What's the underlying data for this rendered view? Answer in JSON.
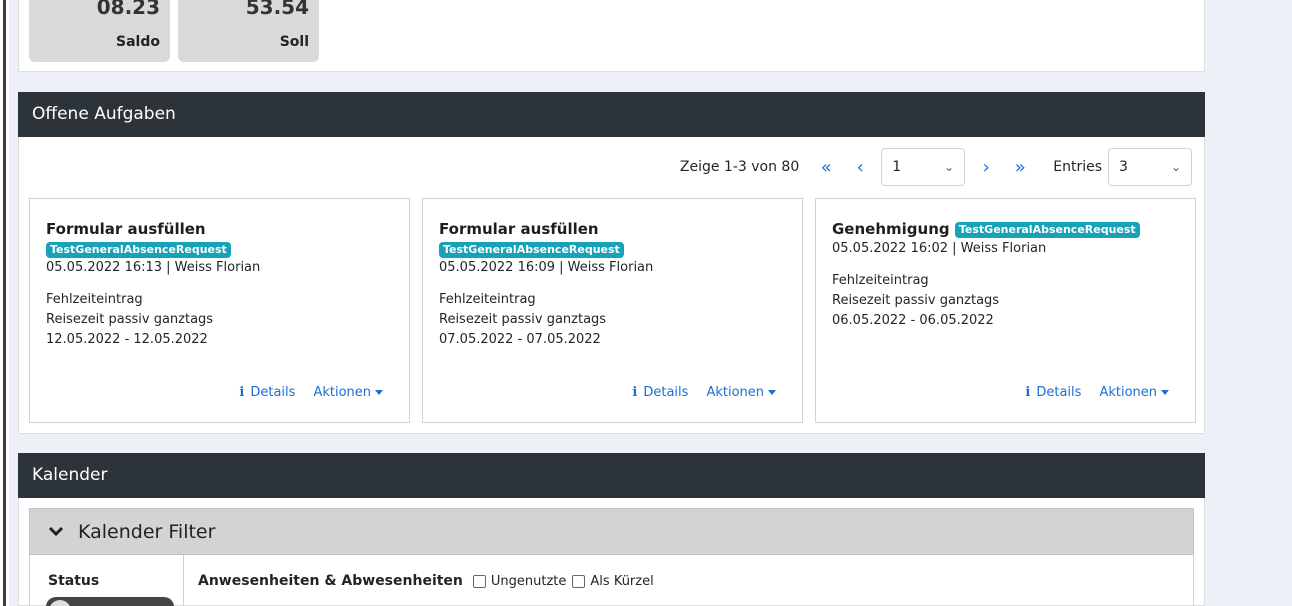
{
  "stats": [
    {
      "value": "08.23",
      "label": "Saldo"
    },
    {
      "value": "53.54",
      "label": "Soll"
    }
  ],
  "tasks_section": {
    "title": "Offene Aufgaben",
    "pager": {
      "info": "Zeige 1-3 von 80",
      "first_icon": "«",
      "prev_icon": "‹",
      "page_value": "1",
      "next_icon": "›",
      "last_icon": "»",
      "entries_label": "Entries",
      "entries_value": "3"
    },
    "cards": [
      {
        "title": "Formular ausfüllen",
        "badge": "TestGeneralAbsenceRequest",
        "meta": "05.05.2022 16:13 | Weiss Florian",
        "line1": "Fehlzeiteintrag",
        "line2": "Reisezeit passiv ganztags",
        "line3": "12.05.2022 - 12.05.2022",
        "details": "Details",
        "actions": "Aktionen"
      },
      {
        "title": "Formular ausfüllen",
        "badge": "TestGeneralAbsenceRequest",
        "meta": "05.05.2022 16:09 | Weiss Florian",
        "line1": "Fehlzeiteintrag",
        "line2": "Reisezeit passiv ganztags",
        "line3": "07.05.2022 - 07.05.2022",
        "details": "Details",
        "actions": "Aktionen"
      },
      {
        "title": "Genehmigung",
        "badge": "TestGeneralAbsenceRequest",
        "meta": "05.05.2022 16:02 | Weiss Florian",
        "line1": "Fehlzeiteintrag",
        "line2": "Reisezeit passiv ganztags",
        "line3": "06.05.2022 - 06.05.2022",
        "details": "Details",
        "actions": "Aktionen"
      }
    ]
  },
  "calendar_section": {
    "title": "Kalender",
    "filter_title": "Kalender Filter",
    "status_label": "Status",
    "attendance_label": "Anwesenheiten & Abwesenheiten",
    "checkbox_unused": "Ungenutzte",
    "checkbox_short": "Als Kürzel"
  },
  "colors": {
    "header_bg": "#2d3439",
    "link": "#1a6fd6",
    "badge": "#17a2b8",
    "background": "#edf1f7"
  }
}
